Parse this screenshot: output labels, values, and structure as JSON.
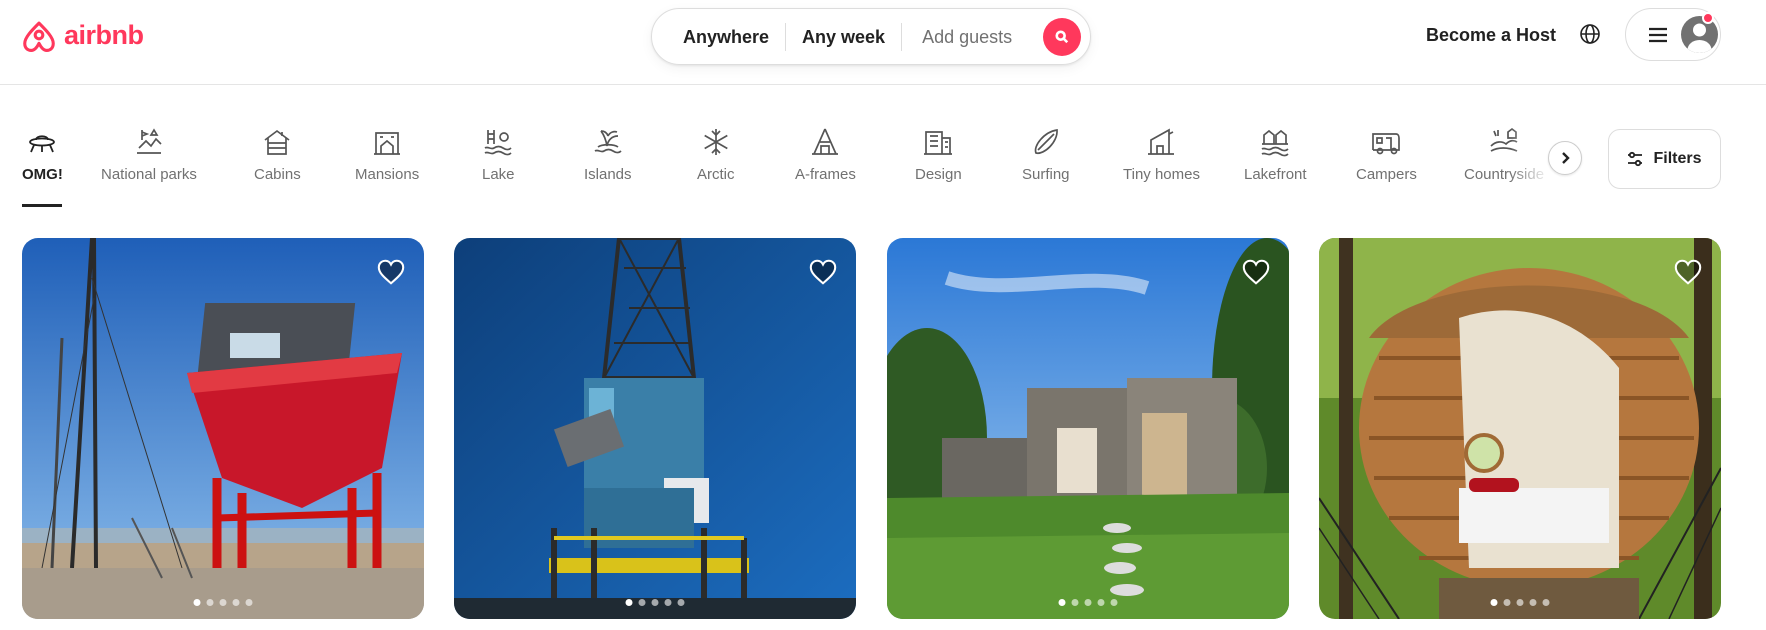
{
  "brand": {
    "name": "airbnb",
    "color": "#ff385c",
    "icon": "airbnb-belo-icon"
  },
  "search": {
    "where": "Anywhere",
    "when": "Any week",
    "guests_placeholder": "Add guests",
    "button_icon": "search-icon"
  },
  "header": {
    "host_link": "Become a Host",
    "globe_icon": "globe-icon",
    "menu_icon": "hamburger-menu-icon",
    "avatar_icon": "user-avatar-icon",
    "has_notification": true
  },
  "categories": {
    "active": "OMG!",
    "items": [
      {
        "label": "OMG!",
        "icon": "ufo-icon"
      },
      {
        "label": "National parks",
        "icon": "national-park-icon"
      },
      {
        "label": "Cabins",
        "icon": "cabin-icon"
      },
      {
        "label": "Mansions",
        "icon": "mansion-icon"
      },
      {
        "label": "Lake",
        "icon": "lake-icon"
      },
      {
        "label": "Islands",
        "icon": "island-icon"
      },
      {
        "label": "Arctic",
        "icon": "snowflake-icon"
      },
      {
        "label": "A-frames",
        "icon": "a-frame-icon"
      },
      {
        "label": "Design",
        "icon": "design-building-icon"
      },
      {
        "label": "Surfing",
        "icon": "surfboard-icon"
      },
      {
        "label": "Tiny homes",
        "icon": "tiny-home-icon"
      },
      {
        "label": "Lakefront",
        "icon": "lakefront-icon"
      },
      {
        "label": "Campers",
        "icon": "camper-icon"
      },
      {
        "label": "Countryside",
        "icon": "countryside-icon"
      }
    ],
    "next_icon": "chevron-right-icon",
    "filters_label": "Filters",
    "filters_icon": "sliders-icon"
  },
  "listings": [
    {
      "photo": "red-crane-cabin-harbor-photo",
      "photo_count": 5,
      "current_photo": 1
    },
    {
      "photo": "blue-harbor-crane-photo",
      "photo_count": 5,
      "current_photo": 1
    },
    {
      "photo": "round-wooden-houses-garden-photo",
      "photo_count": 5,
      "current_photo": 1
    },
    {
      "photo": "shingled-treehouse-pod-photo",
      "photo_count": 5,
      "current_photo": 1
    }
  ]
}
